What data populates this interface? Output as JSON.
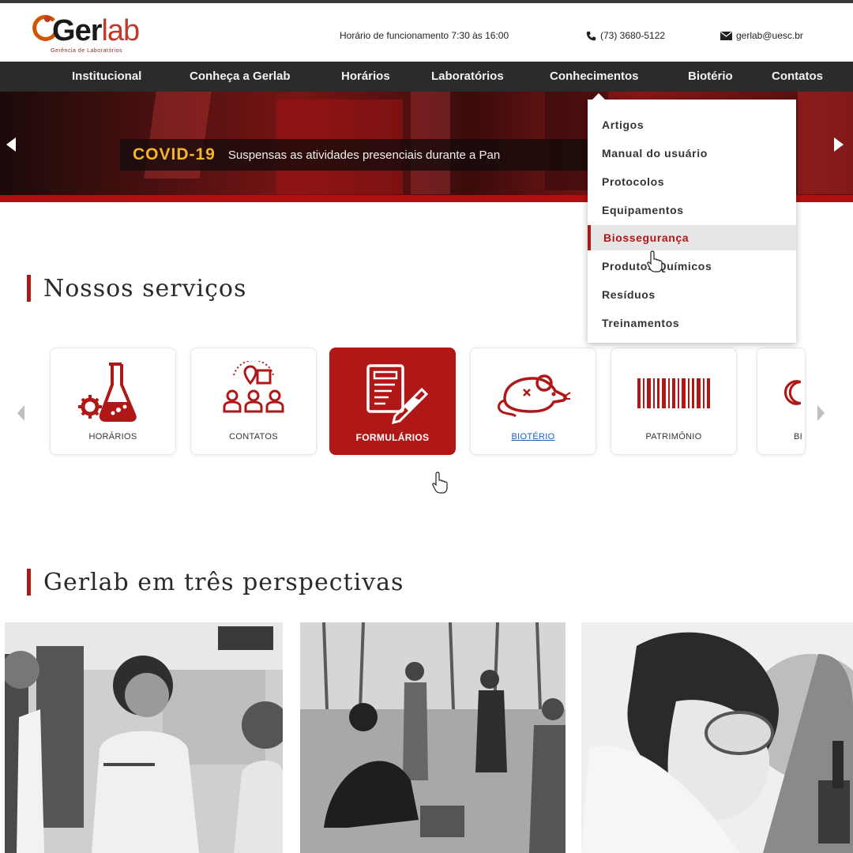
{
  "header": {
    "logo": {
      "word_start": "G",
      "word_mid": "er",
      "word_end": "lab",
      "tagline": "Gerência de Laboratórios"
    },
    "hours": "Horário de funcionamento 7:30 às 16:00",
    "phone": "(73) 3680-5122",
    "email": "gerlab@uesc.br"
  },
  "nav": {
    "items": [
      "Institucional",
      "Conheça a Gerlab",
      "Horários",
      "Laboratórios",
      "Conhecimentos",
      "Biotério",
      "Contatos"
    ]
  },
  "banner": {
    "tag": "COVID-19",
    "text": "Suspensas as atividades presenciais durante a Pan"
  },
  "dropdown": {
    "items": [
      "Artigos",
      "Manual do usuário",
      "Protocolos",
      "Equipamentos",
      "Biossegurança",
      "Produtos Químicos",
      "Resíduos",
      "Treinamentos"
    ],
    "active_index": 4
  },
  "services": {
    "title": "Nossos serviços",
    "cards": [
      {
        "label": "HORÁRIOS",
        "icon": "flask-gear-icon"
      },
      {
        "label": "CONTATOS",
        "icon": "team-location-icon"
      },
      {
        "label": "FORMULÁRIOS",
        "icon": "forms-icon",
        "active": true
      },
      {
        "label": "BIOTÉRIO",
        "icon": "mouse-icon"
      },
      {
        "label": "PATRIMÔNIO",
        "icon": "barcode-icon"
      },
      {
        "label": "BI",
        "icon": "moon-icon"
      }
    ]
  },
  "perspectives": {
    "title": "Gerlab em três perspectivas",
    "photos": [
      "lab-team-photo",
      "field-work-photo",
      "microscope-photo"
    ]
  },
  "colors": {
    "accent": "#b01818",
    "nav_bg": "#2b2b2b",
    "covid": "#f5b52a"
  }
}
